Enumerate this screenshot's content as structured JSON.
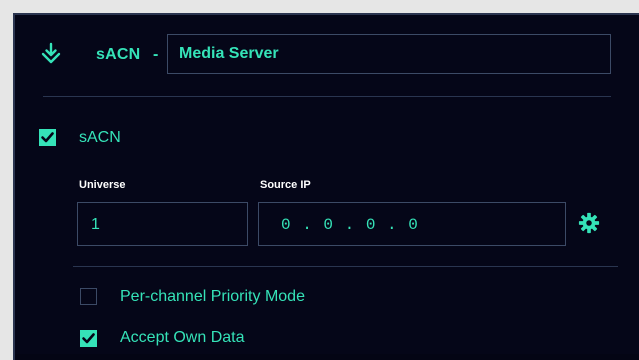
{
  "header": {
    "title": "sACN",
    "separator": "-",
    "name_value": "Media Server"
  },
  "sacn_toggle": {
    "label": "sACN",
    "checked": true
  },
  "universe": {
    "label": "Universe",
    "value": "1"
  },
  "source_ip": {
    "label": "Source IP",
    "value": "0 . 0 . 0 . 0"
  },
  "options": [
    {
      "label": "Per-channel Priority Mode",
      "checked": false
    },
    {
      "label": "Accept Own Data",
      "checked": true
    }
  ],
  "colors": {
    "accent": "#35e3b8",
    "background": "#050618",
    "border": "#3c4a66"
  },
  "icons": {
    "header": "download-arrow-icon",
    "settings": "gear-icon",
    "check": "checkmark-icon"
  }
}
